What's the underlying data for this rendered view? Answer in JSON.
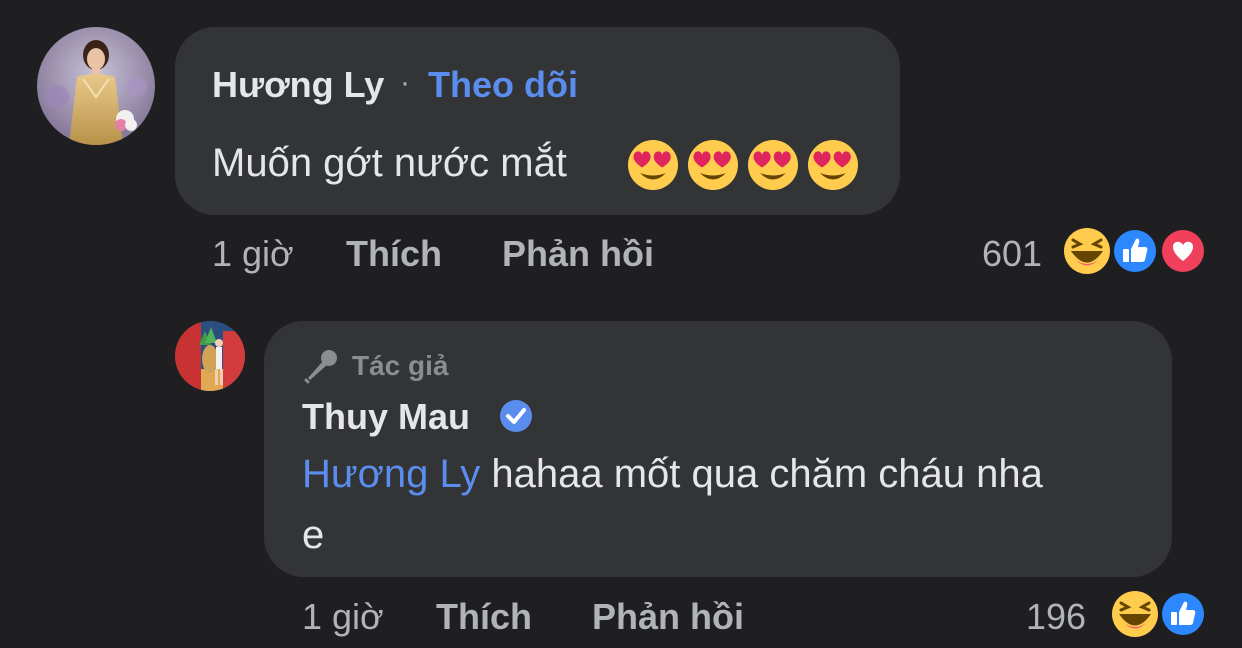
{
  "comment": {
    "author": "Hương Ly",
    "separator": "·",
    "follow_label": "Theo dõi",
    "text": "Muốn gớt nước mắt",
    "emojis": [
      "heart-eyes-emoji",
      "heart-eyes-emoji",
      "heart-eyes-emoji",
      "heart-eyes-emoji"
    ],
    "time": "1 giờ",
    "like_label": "Thích",
    "reply_label": "Phản hồi",
    "reaction_count": "601",
    "reactions": [
      "haha-icon",
      "like-icon",
      "love-icon"
    ]
  },
  "reply": {
    "badge_label": "Tác giả",
    "badge_icon": "microphone-icon",
    "author": "Thuy Mau",
    "verified_icon": "verified-badge-icon",
    "mention": "Hương Ly",
    "text_line1": " hahaa mốt qua chăm cháu nha",
    "text_line2": "e",
    "time": "1 giờ",
    "like_label": "Thích",
    "reply_label": "Phản hồi",
    "reaction_count": "196",
    "reactions": [
      "haha-icon",
      "like-icon"
    ]
  },
  "colors": {
    "background": "#1f1f21",
    "bubble": "#333436",
    "link": "#5b8dee",
    "muted": "#b0b3b8"
  }
}
